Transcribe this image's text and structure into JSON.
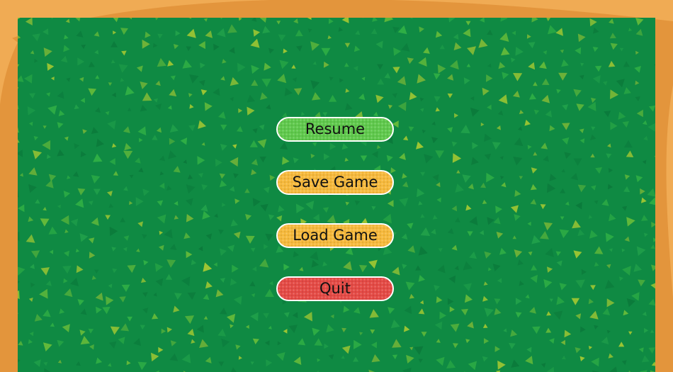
{
  "pause_menu": {
    "buttons": [
      {
        "id": "resume",
        "label": "Resume",
        "color": "#5fc94c"
      },
      {
        "id": "save-game",
        "label": "Save Game",
        "color": "#f6b93c"
      },
      {
        "id": "load-game",
        "label": "Load Game",
        "color": "#f6b93c"
      },
      {
        "id": "quit",
        "label": "Quit",
        "color": "#e44a45"
      }
    ]
  },
  "theme": {
    "frame_color": "#e3953c",
    "frame_swirl_color": "#f0ab54",
    "board_color": "#0f8a43",
    "pattern_colors": [
      "#21a04a",
      "#2fae45",
      "#63b93a",
      "#9dc533",
      "#0b7a3b"
    ]
  }
}
